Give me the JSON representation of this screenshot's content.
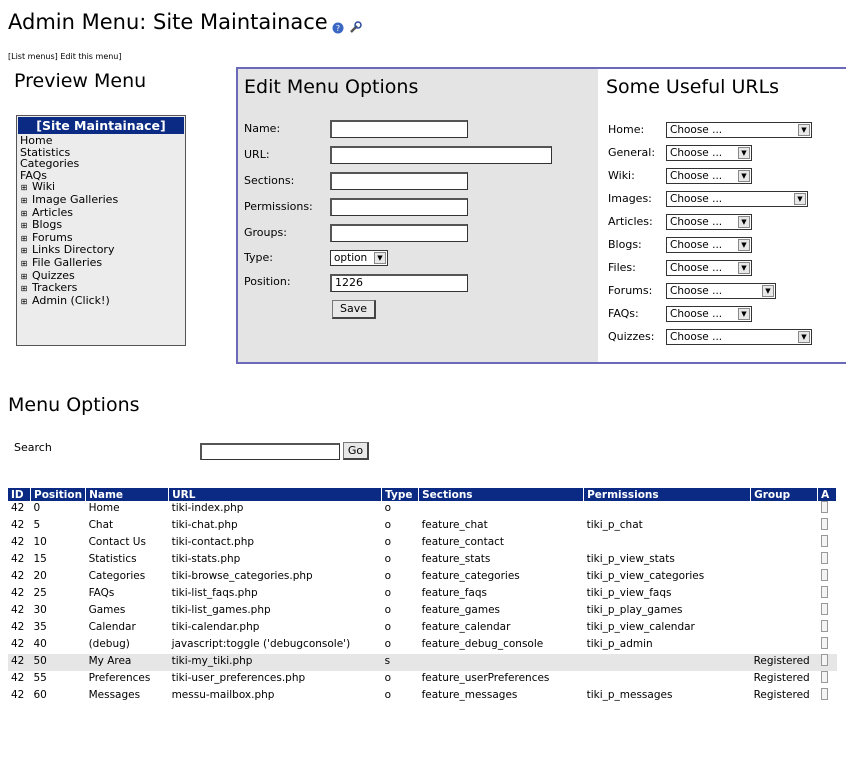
{
  "page": {
    "title": "Admin Menu: Site Maintainace",
    "links": [
      "[List menus]",
      "Edit this menu]"
    ]
  },
  "preview": {
    "heading": "Preview Menu",
    "menu_title": "[Site Maintainace]",
    "items": [
      "Home",
      "Statistics",
      "Categories",
      "FAQs"
    ],
    "sections": [
      "Wiki",
      "Image Galleries",
      "Articles",
      "Blogs",
      "Forums",
      "Links Directory",
      "File Galleries",
      "Quizzes",
      "Trackers",
      "Admin (Click!)"
    ]
  },
  "edit": {
    "heading": "Edit Menu Options",
    "name_label": "Name:",
    "url_label": "URL:",
    "sections_label": "Sections:",
    "permissions_label": "Permissions:",
    "groups_label": "Groups:",
    "type_label": "Type:",
    "type_value": "option",
    "position_label": "Position:",
    "position_value": "1226",
    "save_label": "Save"
  },
  "urls": {
    "heading": "Some Useful URLs",
    "rows": [
      {
        "label": "Home:",
        "value": "Choose ..."
      },
      {
        "label": "General:",
        "value": "Choose ..."
      },
      {
        "label": "Wiki:",
        "value": "Choose ..."
      },
      {
        "label": "Images:",
        "value": "Choose ..."
      },
      {
        "label": "Articles:",
        "value": "Choose ..."
      },
      {
        "label": "Blogs:",
        "value": "Choose ..."
      },
      {
        "label": "Files:",
        "value": "Choose ..."
      },
      {
        "label": "Forums:",
        "value": "Choose ..."
      },
      {
        "label": "FAQs:",
        "value": "Choose ..."
      },
      {
        "label": "Quizzes:",
        "value": "Choose ..."
      }
    ]
  },
  "options": {
    "heading": "Menu Options",
    "search_label": "Search",
    "go_label": "Go",
    "columns": [
      "ID",
      "Position",
      "Name",
      "URL",
      "Type",
      "Sections",
      "Permissions",
      "Group",
      "A"
    ],
    "rows": [
      [
        "42",
        "0",
        "Home",
        "tiki-index.php",
        "o",
        "",
        "",
        ""
      ],
      [
        "42",
        "5",
        "Chat",
        "tiki-chat.php",
        "o",
        "feature_chat",
        "tiki_p_chat",
        ""
      ],
      [
        "42",
        "10",
        "Contact Us",
        "tiki-contact.php",
        "o",
        "feature_contact",
        "",
        ""
      ],
      [
        "42",
        "15",
        "Statistics",
        "tiki-stats.php",
        "o",
        "feature_stats",
        "tiki_p_view_stats",
        ""
      ],
      [
        "42",
        "20",
        "Categories",
        "tiki-browse_categories.php",
        "o",
        "feature_categories",
        "tiki_p_view_categories",
        ""
      ],
      [
        "42",
        "25",
        "FAQs",
        "tiki-list_faqs.php",
        "o",
        "feature_faqs",
        "tiki_p_view_faqs",
        ""
      ],
      [
        "42",
        "30",
        "Games",
        "tiki-list_games.php",
        "o",
        "feature_games",
        "tiki_p_play_games",
        ""
      ],
      [
        "42",
        "35",
        "Calendar",
        "tiki-calendar.php",
        "o",
        "feature_calendar",
        "tiki_p_view_calendar",
        ""
      ],
      [
        "42",
        "40",
        "(debug)",
        "javascript:toggle ('debugconsole')",
        "o",
        "feature_debug_console",
        "tiki_p_admin",
        ""
      ],
      [
        "42",
        "50",
        "My Area",
        "tiki-my_tiki.php",
        "s",
        "",
        "",
        "Registered"
      ],
      [
        "42",
        "55",
        "Preferences",
        "tiki-user_preferences.php",
        "o",
        "feature_userPreferences",
        "",
        "Registered"
      ],
      [
        "42",
        "60",
        "Messages",
        "messu-mailbox.php",
        "o",
        "feature_messages",
        "tiki_p_messages",
        "Registered"
      ]
    ]
  }
}
